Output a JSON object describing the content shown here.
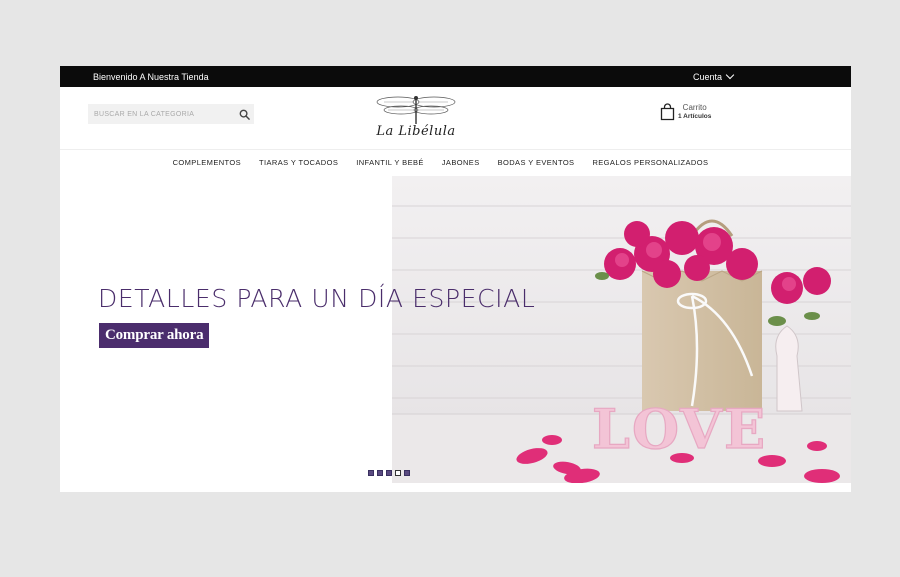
{
  "topbar": {
    "welcome": "Bienvenido A Nuestra Tienda",
    "account_label": "Cuenta"
  },
  "search": {
    "placeholder": "BUSCAR EN LA CATEGORIA",
    "icon": "search-icon"
  },
  "logo": {
    "text": "La Libélula",
    "icon": "dragonfly-icon"
  },
  "cart": {
    "title": "Carrito",
    "count": "1 Artículos",
    "icon": "shopping-bag-icon"
  },
  "nav": {
    "items": [
      {
        "label": "COMPLEMENTOS"
      },
      {
        "label": "TIARAS Y TOCADOS"
      },
      {
        "label": "INFANTIL Y BEBÉ"
      },
      {
        "label": "JABONES"
      },
      {
        "label": "BODAS Y EVENTOS"
      },
      {
        "label": "REGALOS PERSONALIZADOS"
      }
    ]
  },
  "hero": {
    "title": "DETALLES PARA UN DÍA ESPECIAL",
    "cta": "Comprar ahora",
    "photo_text": "LOVE",
    "slides": 5,
    "active_slide": 4
  },
  "colors": {
    "accent": "#4b2d6d",
    "topbar": "#0b0b0b",
    "background": "#e6e6e6"
  }
}
